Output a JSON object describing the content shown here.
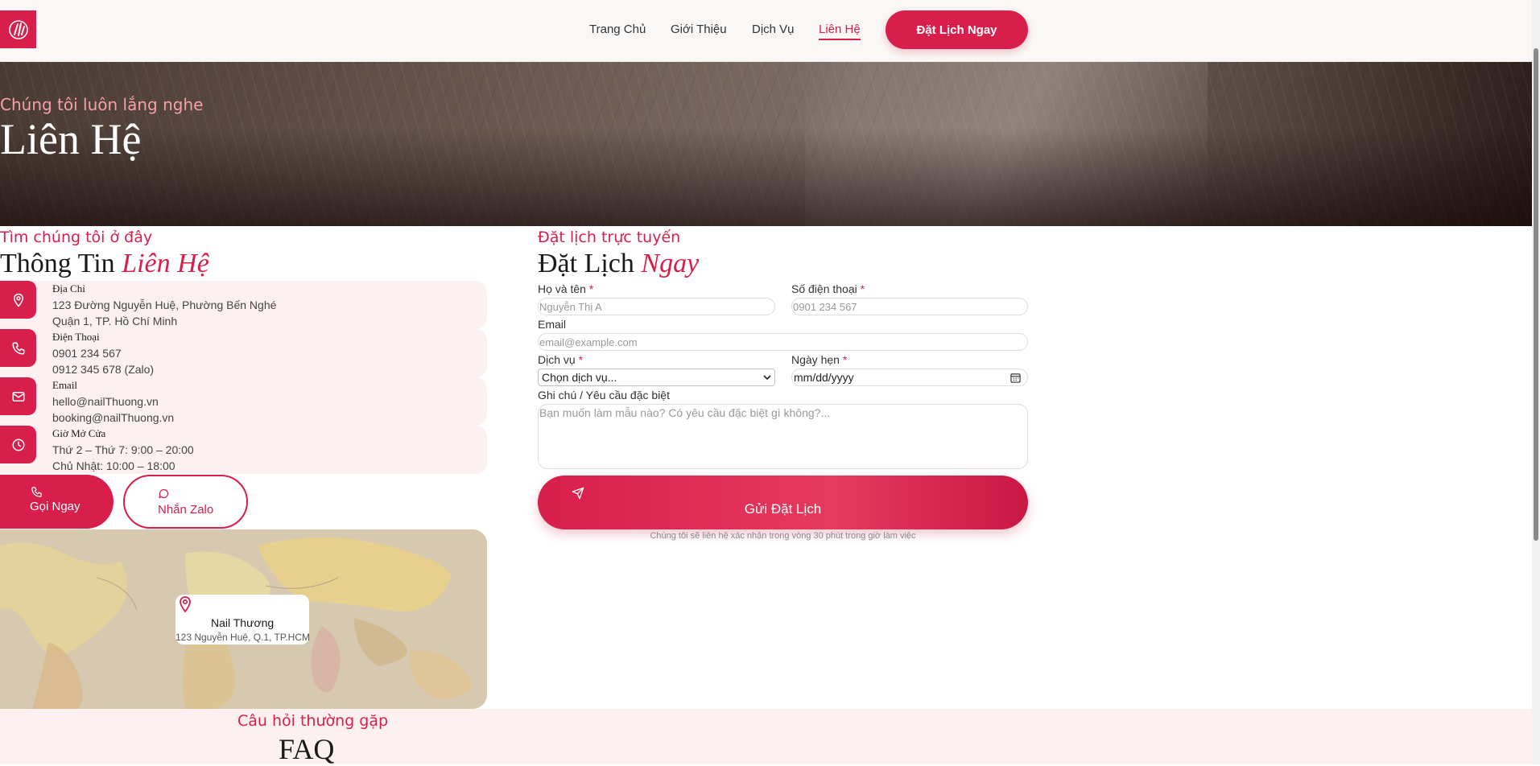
{
  "header": {
    "nav": [
      "Trang Chủ",
      "Giới Thiệu",
      "Dịch Vụ",
      "Liên Hệ"
    ],
    "active_nav": "Liên Hệ",
    "book_button": "Đặt Lịch Ngay",
    "logo_icon": "nail-hand-logo-icon"
  },
  "hero": {
    "subtitle": "Chúng tôi luôn lắng nghe",
    "title": "Liên Hệ"
  },
  "contact": {
    "kicker": "Tìm chúng tôi ở đây",
    "title_plain": "Thông Tin",
    "title_em": "Liên Hệ",
    "items": [
      {
        "icon": "map-pin-icon",
        "label": "Địa Chỉ",
        "lines": [
          "123 Đường Nguyễn Huệ, Phường Bến Nghé",
          "Quận 1, TP. Hồ Chí Minh"
        ]
      },
      {
        "icon": "phone-icon",
        "label": "Điện Thoại",
        "lines": [
          "0901 234 567",
          "0912 345 678 (Zalo)"
        ]
      },
      {
        "icon": "mail-icon",
        "label": "Email",
        "lines": [
          "hello@nailThuong.vn",
          "booking@nailThuong.vn"
        ]
      },
      {
        "icon": "clock-icon",
        "label": "Giờ Mở Cửa",
        "lines": [
          "Thứ 2 – Thứ 7: 9:00 – 20:00",
          "Chủ Nhật: 10:00 – 18:00"
        ]
      }
    ],
    "call_button": "Gọi Ngay",
    "zalo_button": "Nhắn Zalo"
  },
  "map": {
    "name": "Nail Thương",
    "address": "123 Nguyễn Huệ, Q.1, TP.HCM"
  },
  "booking": {
    "kicker": "Đặt lịch trực tuyến",
    "title_plain": "Đặt Lịch",
    "title_em": "Ngay",
    "name_label": "Họ và tên",
    "name_placeholder": "Nguyễn Thị A",
    "phone_label": "Số điện thoại",
    "phone_placeholder": "0901 234 567",
    "email_label": "Email",
    "email_placeholder": "email@example.com",
    "service_label": "Dịch vụ",
    "service_value": "Chọn dịch vụ...",
    "date_label": "Ngày hẹn",
    "date_value": "mm/dd/yyyy",
    "note_label": "Ghi chú / Yêu cầu đặc biệt",
    "note_placeholder": "Bạn muốn làm mẫu nào? Có yêu cầu đặc biệt gì không?...",
    "required_mark": "*",
    "submit": "Gửi Đặt Lịch",
    "note": "Chúng tôi sẽ liên hệ xác nhận trong vòng 30 phút trong giờ làm việc"
  },
  "faq": {
    "kicker": "Câu hỏi thường gặp",
    "title": "FAQ"
  },
  "colors": {
    "accent": "#d81e4a",
    "soft_pink": "#fdf0f1"
  }
}
